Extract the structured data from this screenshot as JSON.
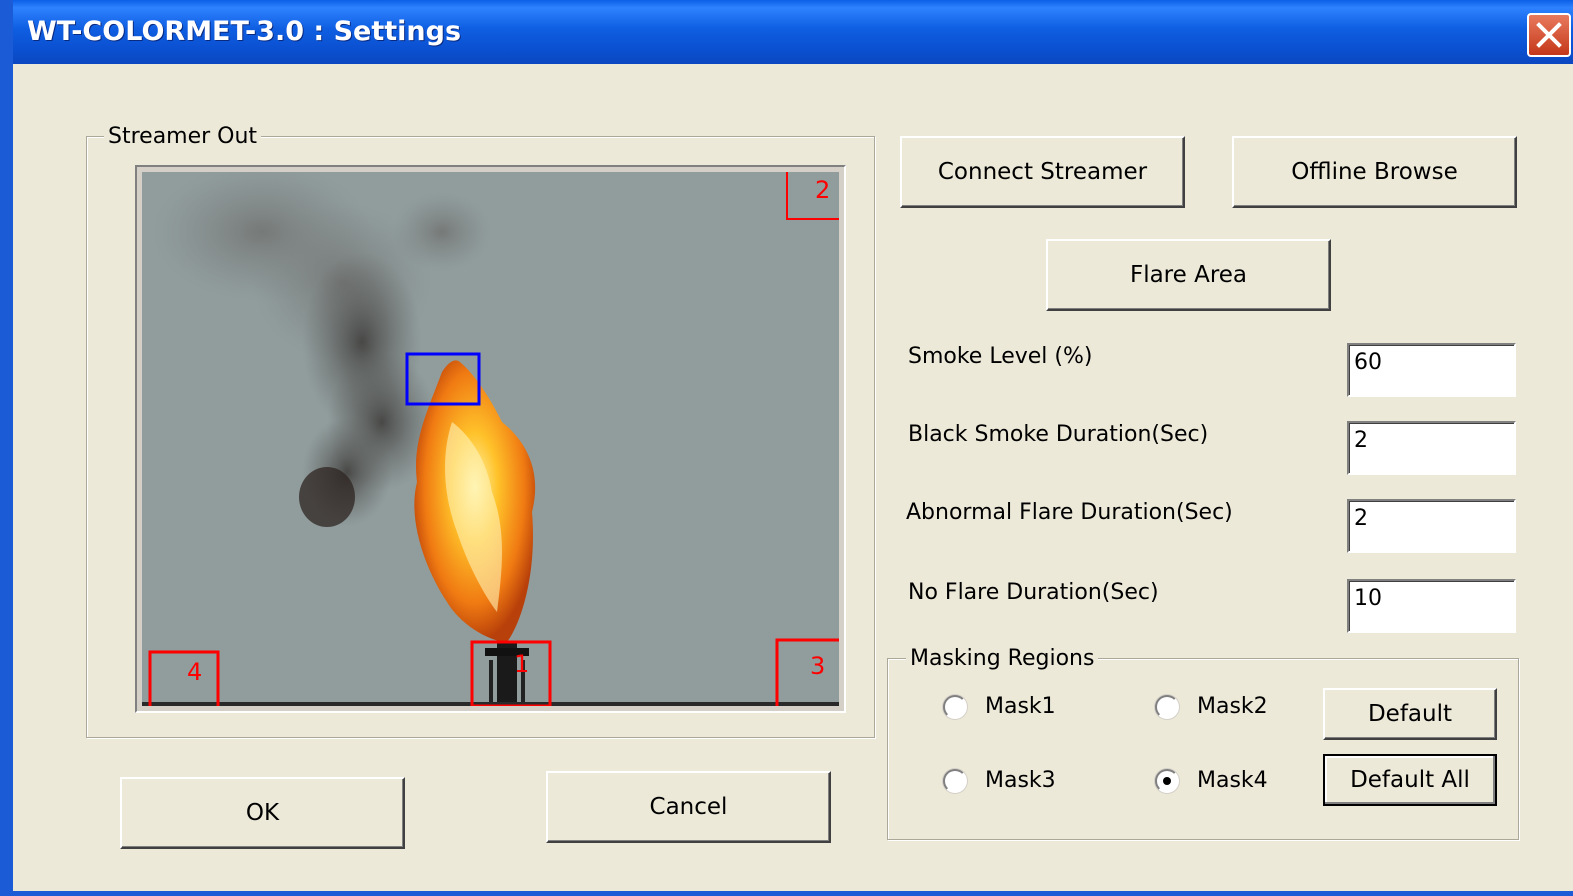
{
  "window": {
    "title": "WT-COLORMET-3.0 : Settings",
    "close_icon": "close-icon"
  },
  "streamer_group": {
    "label": "Streamer Out",
    "region_labels": [
      "1",
      "2",
      "3",
      "4"
    ]
  },
  "buttons": {
    "connect_streamer": "Connect Streamer",
    "offline_browse": "Offline Browse",
    "flare_area": "Flare Area",
    "ok": "OK",
    "cancel": "Cancel"
  },
  "fields": {
    "smoke_level": {
      "label": "Smoke Level (%)",
      "value": "60"
    },
    "black_smoke_duration": {
      "label": "Black Smoke Duration(Sec)",
      "value": "2"
    },
    "abnormal_flare_duration": {
      "label": "Abnormal Flare Duration(Sec)",
      "value": "2"
    },
    "no_flare_duration": {
      "label": "No Flare Duration(Sec)",
      "value": "10"
    }
  },
  "masking": {
    "label": "Masking Regions",
    "mask1": "Mask1",
    "mask2": "Mask2",
    "mask3": "Mask3",
    "mask4": "Mask4",
    "selected": "Mask4",
    "default_button": "Default",
    "default_all_button": "Default All"
  },
  "colors": {
    "titlebar": "#0a5fe6",
    "dialog_bg": "#ece9d8",
    "region_marker": "#ff0000",
    "flare_roi": "#0000ff"
  }
}
